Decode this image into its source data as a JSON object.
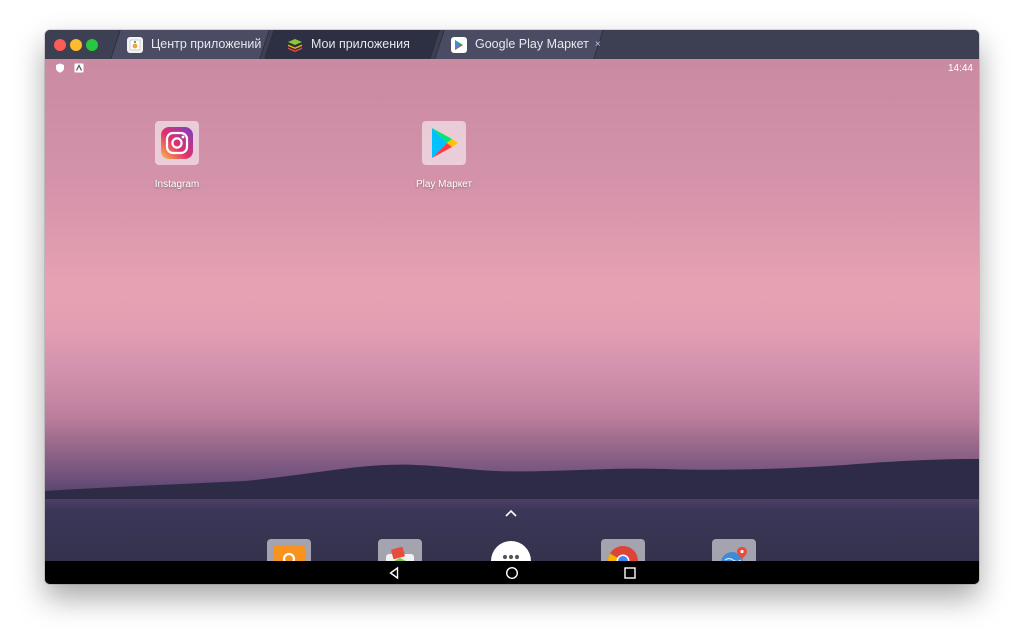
{
  "tabs": [
    {
      "label": "Центр приложений",
      "icon": "app-center-icon",
      "active": false
    },
    {
      "label": "Мои приложения",
      "icon": "bluestacks-icon",
      "active": true
    },
    {
      "label": "Google Play Маркет",
      "icon": "play-store-icon",
      "active": false,
      "close": "×"
    }
  ],
  "statusbar": {
    "time": "14:44",
    "icons": [
      "shield-icon",
      "notification-icon"
    ]
  },
  "desktop": {
    "apps": [
      {
        "label": "Instagram",
        "icon": "instagram-icon"
      },
      {
        "label": "Play Маркет",
        "icon": "play-store-icon"
      }
    ]
  },
  "dock": {
    "items": [
      "search-app-icon",
      "app-installer-icon",
      "app-drawer-icon",
      "chrome-icon",
      "maps-icon"
    ]
  },
  "navbar": {
    "buttons": [
      "back-icon",
      "home-icon",
      "recents-icon"
    ]
  },
  "colors": {
    "titlebar": "#3d3f53",
    "active_tab": "#2d2f42",
    "traffic_red": "#fd5c56",
    "traffic_yellow": "#fdbc2e",
    "traffic_green": "#27c840"
  }
}
